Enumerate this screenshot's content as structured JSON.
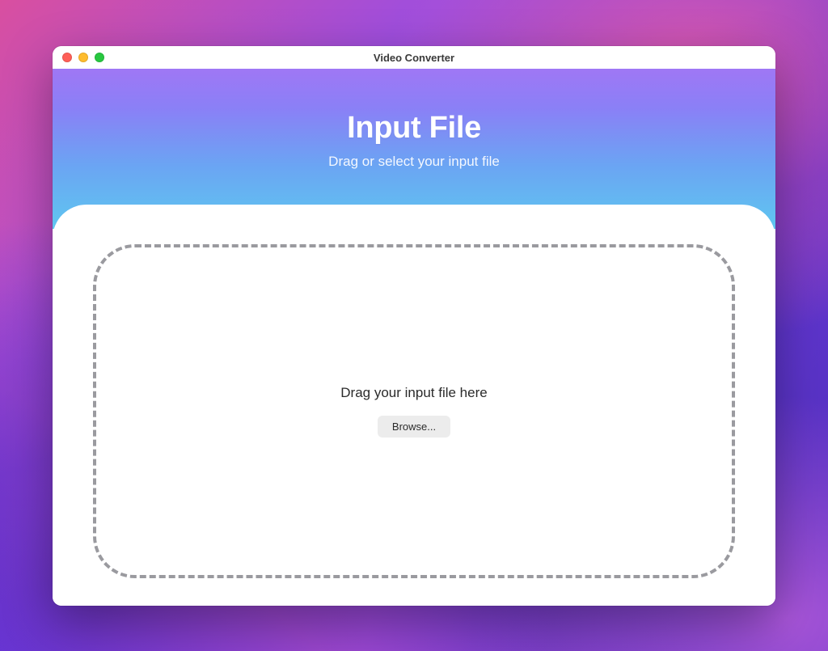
{
  "window": {
    "title": "Video Converter"
  },
  "header": {
    "title": "Input File",
    "subtitle": "Drag or select your input file"
  },
  "dropzone": {
    "instruction": "Drag your input file here",
    "browse_label": "Browse..."
  },
  "colors": {
    "gradient_top": "#9f77f5",
    "gradient_bottom": "#5fc6f0",
    "dash_border": "#9a9a9f"
  }
}
